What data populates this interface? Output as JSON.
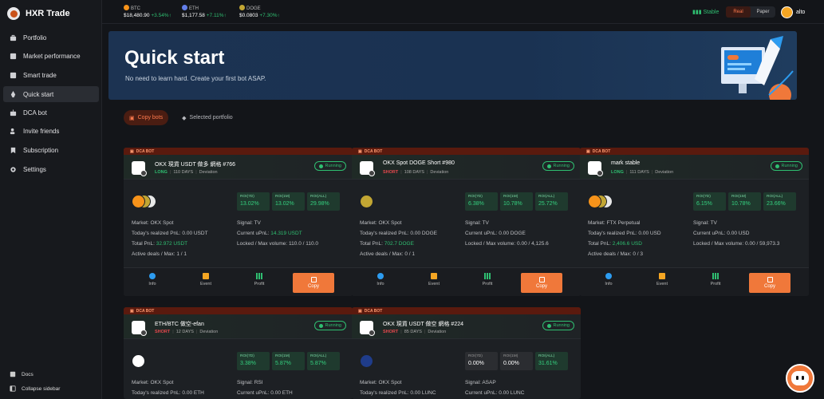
{
  "app": {
    "name": "HXR Trade"
  },
  "sidebar": {
    "items": [
      {
        "label": "Portfolio",
        "icon": "briefcase-icon"
      },
      {
        "label": "Market performance",
        "icon": "market-icon"
      },
      {
        "label": "Smart trade",
        "icon": "smart-trade-icon"
      },
      {
        "label": "Quick start",
        "icon": "rocket-icon",
        "active": true
      },
      {
        "label": "DCA bot",
        "icon": "bot-icon"
      },
      {
        "label": "Invite friends",
        "icon": "user-plus-icon"
      },
      {
        "label": "Subscription",
        "icon": "bookmark-icon"
      },
      {
        "label": "Settings",
        "icon": "gear-icon"
      }
    ],
    "docs_label": "Docs",
    "collapse_label": "Collapse sidebar"
  },
  "ticker": [
    {
      "symbol": "BTC",
      "price": "$18,480.90",
      "change": "+3.54%↑",
      "color": "#f7931a"
    },
    {
      "symbol": "ETH",
      "price": "$1,177.58",
      "change": "+7.11%↑",
      "color": "#627eea"
    },
    {
      "symbol": "DOGE",
      "price": "$0.0803",
      "change": "+7.30%↑",
      "color": "#c2a633"
    }
  ],
  "header": {
    "stable_label": "Stable",
    "mode_real": "Real",
    "mode_paper": "Paper",
    "username": "alto"
  },
  "hero": {
    "title": "Quick start",
    "subtitle": "No need to learn hard. Create your first bot ASAP."
  },
  "tabs": [
    {
      "label": "Copy bots",
      "active": true
    },
    {
      "label": "Selected portfolio",
      "active": false
    }
  ],
  "labels": {
    "tag": "DCA BOT",
    "running": "Running",
    "days_suffix": "DAYS",
    "market": "Market:",
    "signal": "Signal:",
    "today_pnl": "Today's realized PnL:",
    "current_upnl": "Current uPnL:",
    "total_pnl": "Total PnL:",
    "locked_max": "Locked / Max volume:",
    "active_deals": "Active deals / Max:",
    "info": "Info",
    "event": "Event",
    "profit": "Profit",
    "copy": "Copy",
    "roi_7d": "ROI(7D)",
    "roi_1m": "ROI(1M)",
    "roi_all": "ROI(ALL)"
  },
  "cards": [
    {
      "name": "OKX 現貨 USDT 做多 網格 #766",
      "direction": "LONG",
      "days": "110",
      "strategy": "Deviation",
      "coins": [
        "#f7931a",
        "#c2a633",
        "#e8e8e8"
      ],
      "roi": [
        "13.02%",
        "13.02%",
        "29.98%"
      ],
      "market": "OKX Spot",
      "signal": "TV",
      "today_pnl": "0.00 USDT",
      "current_upnl": "14.319 USDT",
      "total_pnl": "32.972 USDT",
      "locked_max": "110.0 / 110.0",
      "active_deals": "1 / 1"
    },
    {
      "name": "OKX Spot DOGE Short #980",
      "direction": "SHORT",
      "days": "108",
      "strategy": "Deviation",
      "coins": [
        "#c2a633"
      ],
      "roi": [
        "6.38%",
        "10.78%",
        "25.72%"
      ],
      "market": "OKX Spot",
      "signal": "TV",
      "today_pnl": "0.00 DOGE",
      "current_upnl": "0.00 DOGE",
      "total_pnl": "702.7 DOGE",
      "locked_max": "0.00 / 4,125.6",
      "active_deals": "0 / 1"
    },
    {
      "name": "mark stable",
      "direction": "LONG",
      "days": "111",
      "strategy": "Deviation",
      "coins": [
        "#f7931a",
        "#c2a633",
        "#e8e8e8"
      ],
      "roi": [
        "6.15%",
        "10.78%",
        "23.66%"
      ],
      "market": "FTX Perpetual",
      "signal": "TV",
      "today_pnl": "0.00 USD",
      "current_upnl": "0.00 USD",
      "total_pnl": "2,406.6 USD",
      "locked_max": "0.00 / 59,973.3",
      "active_deals": "0 / 3"
    },
    {
      "name": "ETH/BTC 做空-efan",
      "direction": "SHORT",
      "days": "12",
      "strategy": "Deviation",
      "coins": [
        "#ffffff"
      ],
      "roi": [
        "3.38%",
        "5.87%",
        "5.87%"
      ],
      "market": "OKX Spot",
      "signal": "RSI",
      "today_pnl": "0.00 ETH",
      "current_upnl": "0.00 ETH",
      "total_pnl": "",
      "locked_max": "",
      "active_deals": ""
    },
    {
      "name": "OKX 現貨 USDT 做空 網格 #224",
      "direction": "SHORT",
      "days": "85",
      "strategy": "Deviation",
      "coins": [
        "#1f3c8a"
      ],
      "roi": [
        "0.00%",
        "0.00%",
        "31.61%"
      ],
      "roi_gray": [
        true,
        true,
        false
      ],
      "market": "OKX Spot",
      "signal": "ASAP",
      "today_pnl": "0.00 LUNC",
      "current_upnl": "0.00 LUNC",
      "total_pnl": "",
      "locked_max": "",
      "active_deals": ""
    }
  ],
  "colors": {
    "accent": "#f0783a",
    "green": "#2fbf71",
    "red": "#e5484d",
    "hero_bg": "#1c3352"
  }
}
